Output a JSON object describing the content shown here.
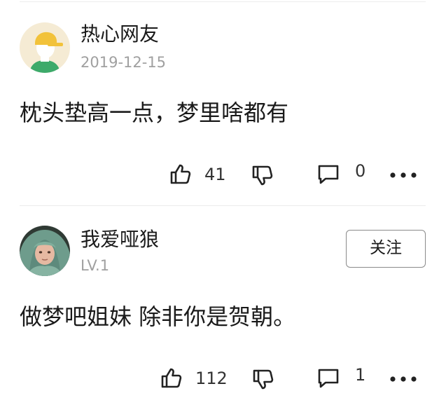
{
  "comments": [
    {
      "username": "热心网友",
      "meta": "2019-12-15",
      "text": "枕头垫高一点，梦里啥都有",
      "likes": "41",
      "replies": "0",
      "follow_label": ""
    },
    {
      "username": "我爱哑狼",
      "meta": "LV.1",
      "text": "做梦吧姐妹 除非你是贺朝。",
      "likes": "112",
      "replies": "1",
      "follow_label": "关注"
    }
  ],
  "icons": {
    "like": "thumbs-up-icon",
    "dislike": "thumbs-down-icon",
    "reply": "comment-icon",
    "more": "more-dots-icon",
    "default_avatar": "user-avatar-yellow-cap"
  },
  "colors": {
    "avatar_bg": "#f5ebd4",
    "avatar_cap": "#f2c23a",
    "avatar_shirt": "#3daa6a",
    "meta_text": "#a0a0a0",
    "icon_stroke": "#222222"
  }
}
